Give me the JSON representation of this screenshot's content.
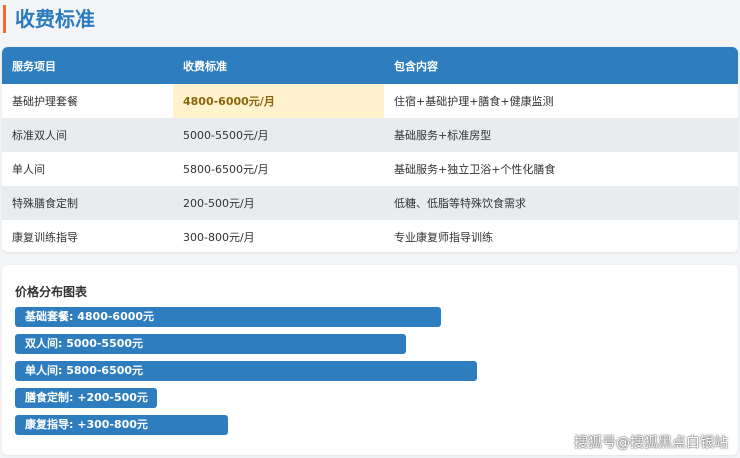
{
  "title": "收费标准",
  "table": {
    "headers": [
      "服务项目",
      "收费标准",
      "包含内容"
    ],
    "rows": [
      [
        "基础护理套餐",
        "4800-6000元/月",
        "住宿+基础护理+膳食+健康监测"
      ],
      [
        "标准双人间",
        "5000-5500元/月",
        "基础服务+标准房型"
      ],
      [
        "单人间",
        "5800-6500元/月",
        "基础服务+独立卫浴+个性化膳食"
      ],
      [
        "特殊膳食定制",
        "200-500元/月",
        "低糖、低脂等特殊饮食需求"
      ],
      [
        "康复训练指导",
        "300-800元/月",
        "专业康复师指导训练"
      ]
    ]
  },
  "chart_data": {
    "type": "bar",
    "title": "价格分布图表",
    "categories": [
      "基础套餐: 4800-6000元",
      "双人间: 5000-5500元",
      "单人间: 5800-6500元",
      "膳食定制: +200-500元",
      "康复指导: +300-800元"
    ],
    "values": [
      60,
      55,
      65,
      20,
      30
    ],
    "unit": "percent of track"
  },
  "watermark": "搜狐号@搜狐黑点白银站",
  "colors": {
    "accent": "#2e7dbf",
    "highlight": "#fff2cc",
    "title_bar": "#f26b2c"
  }
}
